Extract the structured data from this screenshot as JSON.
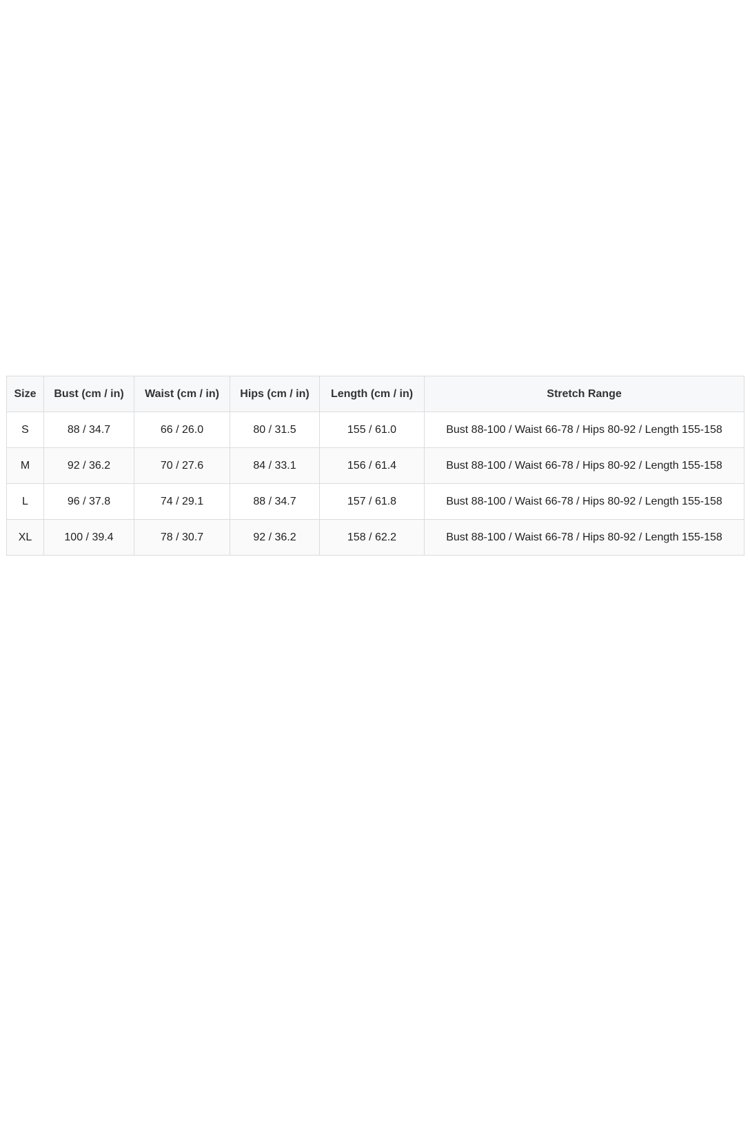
{
  "size_chart": {
    "headers": [
      "Size",
      "Bust (cm / in)",
      "Waist (cm / in)",
      "Hips (cm / in)",
      "Length (cm / in)",
      "Stretch Range"
    ],
    "rows": [
      [
        "S",
        "88 / 34.7",
        "66 / 26.0",
        "80 / 31.5",
        "155 / 61.0",
        "Bust 88-100 / Waist 66-78 / Hips 80-92 / Length 155-158"
      ],
      [
        "M",
        "92 / 36.2",
        "70 / 27.6",
        "84 / 33.1",
        "156 / 61.4",
        "Bust 88-100 / Waist 66-78 / Hips 80-92 / Length 155-158"
      ],
      [
        "L",
        "96 / 37.8",
        "74 / 29.1",
        "88 / 34.7",
        "157 / 61.8",
        "Bust 88-100 / Waist 66-78 / Hips 80-92 / Length 155-158"
      ],
      [
        "XL",
        "100 / 39.4",
        "78 / 30.7",
        "92 / 36.2",
        "158 / 62.2",
        "Bust 88-100 / Waist 66-78 / Hips 80-92 / Length 155-158"
      ]
    ]
  }
}
